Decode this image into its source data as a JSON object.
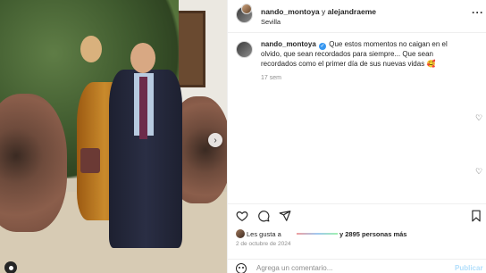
{
  "post": {
    "header": {
      "user_primary": "nando_montoya",
      "connector": " y ",
      "user_secondary": "alejandraeme",
      "location": "Sevilla",
      "more_icon": "more-horizontal-icon"
    },
    "caption": {
      "username": "nando_montoya",
      "text_part1": "Que estos momentos no caigan en el olvido, que sean recordados para siempre... Que sean recordados como el primer día de sus nuevas vidas ",
      "emoji": "🥰",
      "time_ago": "17 sem"
    },
    "actions": {
      "like_icon": "heart-icon",
      "comment_icon": "comment-icon",
      "share_icon": "share-icon",
      "save_icon": "bookmark-icon"
    },
    "likes": {
      "prefix": "Les gusta a",
      "suffix": "y 2895 personas más"
    },
    "date": "2 de octubre de 2024",
    "comment_box": {
      "placeholder": "Agrega un comentario...",
      "publish_label": "Publicar"
    }
  }
}
